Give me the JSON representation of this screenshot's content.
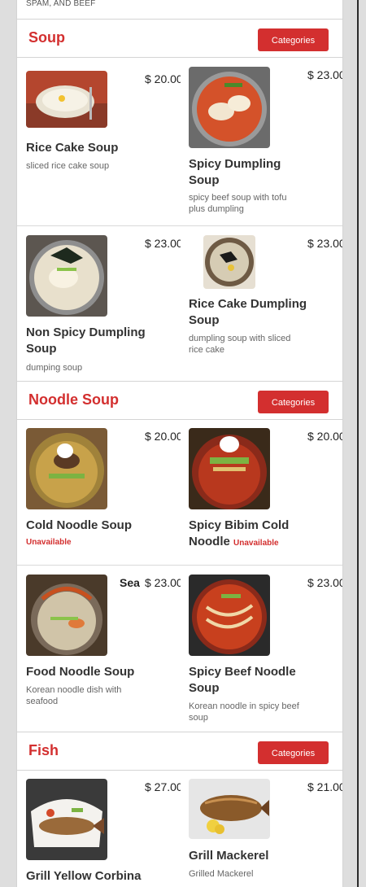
{
  "top_snippet": "SPAM, AND BEEF",
  "sections": [
    {
      "title": "Soup",
      "button": "Categories",
      "items": [
        {
          "name": "Rice Cake Soup",
          "price": "$ 20.00",
          "desc": "sliced rice cake soup"
        },
        {
          "name": "Spicy Dumpling Soup",
          "price": "$ 23.00",
          "desc": "spicy beef soup with tofu plus dumpling"
        },
        {
          "name": "Non Spicy Dumpling Soup",
          "price": "$ 23.00",
          "desc": "dumping soup"
        },
        {
          "name": "Rice Cake Dumpling Soup",
          "price": "$ 23.00",
          "desc": "dumpling soup with sliced rice cake"
        }
      ]
    },
    {
      "title": "Noodle Soup",
      "button": "Categories",
      "items": [
        {
          "name": "Cold Noodle Soup",
          "price": "$ 20.00",
          "status": "Unavailable"
        },
        {
          "name": "Spicy Bibim Cold Noodle",
          "price": "$ 20.00",
          "status": "Unavailable"
        },
        {
          "name": "Food Noodle Soup",
          "name_prefix": "Sea",
          "price": "$ 23.00",
          "desc": "Korean noodle dish with seafood"
        },
        {
          "name": "Spicy Beef Noodle Soup",
          "price": "$ 23.00",
          "desc": "Korean noodle in spicy beef soup"
        }
      ]
    },
    {
      "title": "Fish",
      "button": "Categories",
      "items": [
        {
          "name": "Grill Yellow Corbina",
          "price": "$ 27.00"
        },
        {
          "name": "Grill Mackerel",
          "price": "$ 21.00",
          "desc": "Grilled Mackerel"
        }
      ]
    }
  ],
  "colors": {
    "accent": "#d32f2f",
    "text": "#333333",
    "muted": "#666666"
  }
}
